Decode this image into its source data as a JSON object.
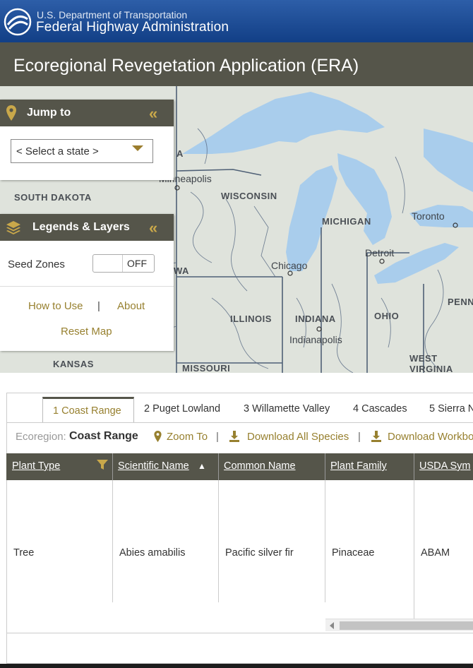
{
  "header": {
    "agency_line1": "U.S. Department of Transportation",
    "agency_line2": "Federal Highway Administration"
  },
  "app": {
    "title": "Ecoregional Revegetation Application (ERA)"
  },
  "map": {
    "labels": {
      "south_dakota": "SOUTH DAKOTA",
      "wisconsin": "WISCONSIN",
      "michigan": "MICHIGAN",
      "illinois": "ILLINOIS",
      "indiana": "INDIANA",
      "ohio": "OHIO",
      "penn": "PENN",
      "west_virginia": "WEST VIRGINIA",
      "kansas": "KANSAS",
      "missouri": "MISSOURI",
      "iowa_fragment": "WA",
      "minnesota_fragment": "A"
    },
    "cities": {
      "minneapolis": "Minneapolis",
      "chicago": "Chicago",
      "detroit": "Detroit",
      "toronto": "Toronto",
      "indianapolis": "Indianapolis"
    }
  },
  "jump_to": {
    "title": "Jump to",
    "select_placeholder": "< Select a state >"
  },
  "legends": {
    "title": "Legends & Layers",
    "seed_zones_label": "Seed Zones",
    "toggle_state": "OFF",
    "how_to_use": "How to Use",
    "separator": "|",
    "about": "About",
    "reset_map": "Reset Map"
  },
  "tabs": [
    {
      "label": "1 Coast Range",
      "active": true
    },
    {
      "label": "2 Puget Lowland",
      "active": false
    },
    {
      "label": "3 Willamette Valley",
      "active": false
    },
    {
      "label": "4 Cascades",
      "active": false
    },
    {
      "label": "5 Sierra N",
      "active": false
    }
  ],
  "ecoregion_bar": {
    "label": "Ecoregion:",
    "value": "Coast Range",
    "zoom_to": "Zoom To",
    "separator": "|",
    "download_all": "Download All Species",
    "download_workbook": "Download Workbo"
  },
  "table": {
    "columns": [
      "Plant Type",
      "Scientific Name",
      "Common Name",
      "Plant Family",
      "USDA Sym"
    ],
    "sort_indicator": "▲",
    "rows": [
      [
        "Tree",
        "Abies amabilis",
        "Pacific silver fir",
        "Pinaceae",
        "ABAM"
      ]
    ]
  },
  "colors": {
    "header_blue": "#1a4a94",
    "olive_bar": "#55554a",
    "gold_accent": "#97802f",
    "water": "#a9cdec"
  }
}
